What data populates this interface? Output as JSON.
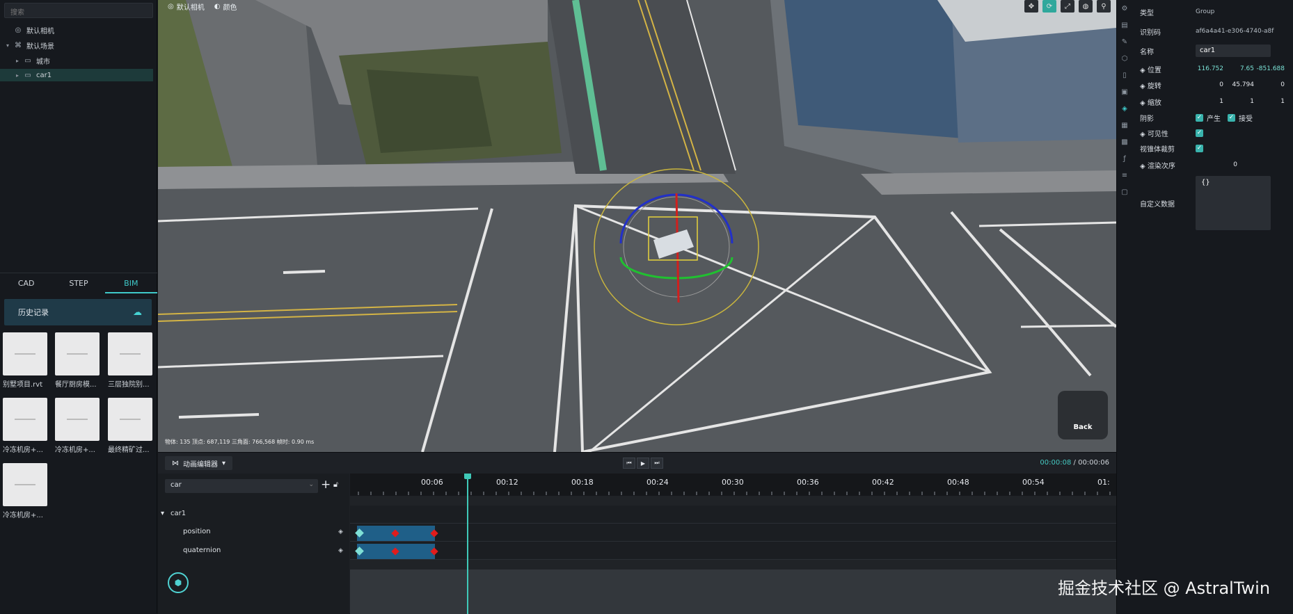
{
  "left": {
    "search_placeholder": "搜索",
    "tree": [
      {
        "label": "默认相机",
        "icon": "camera-icon"
      },
      {
        "label": "默认场景",
        "icon": "scene-icon"
      },
      {
        "label": "城市",
        "icon": "folder-icon"
      },
      {
        "label": "car1",
        "icon": "folder-icon"
      }
    ],
    "tabs": [
      "CAD",
      "STEP",
      "BIM"
    ],
    "active_tab": "BIM",
    "history_label": "历史记录",
    "thumbnails": [
      "别墅项目.rvt",
      "餐厅厨房模...",
      "三层独院别...",
      "冷冻机房+...",
      "冷冻机房+...",
      "最终精矿过...",
      "冷冻机房+..."
    ]
  },
  "viewport": {
    "camera_label": "默认相机",
    "theme_label": "颜色",
    "stats": "物体: 135  顶点: 687,119  三角面: 766,568  帧时: 0.90 ms",
    "back_label": "Back"
  },
  "props": {
    "type_label": "类型",
    "type_value": "Group",
    "id_label": "识别码",
    "id_value": "af6a4a41-e306-4740-a8f",
    "name_label": "名称",
    "name_value": "car1",
    "position_label": "◈ 位置",
    "position": [
      "116.752",
      "7.65",
      "-851.688"
    ],
    "rotation_label": "◈ 旋转",
    "rotation": [
      "0",
      "45.794",
      "0"
    ],
    "scale_label": "◈ 缩放",
    "scale": [
      "1",
      "1",
      "1"
    ],
    "shadow_label": "阴影",
    "cast_label": "产生",
    "receive_label": "接受",
    "visible_label": "◈ 可见性",
    "frustum_label": "视锥体裁剪",
    "render_order_label": "◈ 渲染次序",
    "render_order": "0",
    "custom_label": "自定义数据",
    "custom_value": "{}"
  },
  "timeline": {
    "tab_label": "动画编辑器",
    "current_time": "00:00:08",
    "total_time": "00:00:06",
    "object": "car",
    "root": "car1",
    "tracks": [
      "position",
      "quaternion"
    ],
    "ticks": [
      "00:06",
      "00:12",
      "00:18",
      "00:24",
      "00:30",
      "00:36",
      "00:42",
      "00:48",
      "00:54",
      "01:"
    ]
  },
  "watermark": "掘金技术社区 @ AstralTwin"
}
